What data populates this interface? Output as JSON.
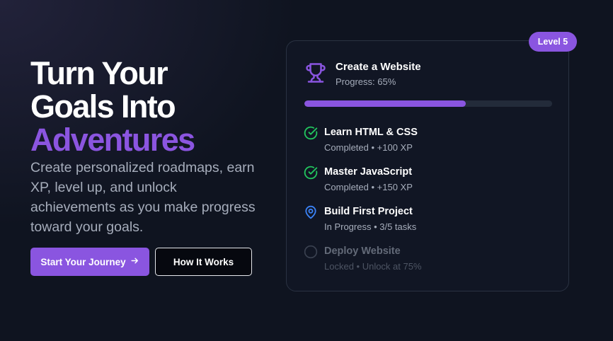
{
  "hero": {
    "headline_line1": "Turn Your",
    "headline_line2": "Goals Into",
    "headline_accent": "Adventures",
    "subtitle": "Create personalized roadmaps, earn XP, level up, and unlock achievements as you make progress toward your goals.",
    "primary_button": "Start Your Journey",
    "primary_button_icon": "arrow-right-icon",
    "secondary_button": "How It Works"
  },
  "card": {
    "badge": "Level 5",
    "icon": "trophy-icon",
    "title": "Create a Website",
    "progress_label": "Progress: 65%",
    "progress": 0.65,
    "tasks": [
      {
        "title": "Learn HTML & CSS",
        "sub": "Completed • +100 XP",
        "status": "completed",
        "icon": "check-circle-icon"
      },
      {
        "title": "Master JavaScript",
        "sub": "Completed • +150 XP",
        "status": "completed",
        "icon": "check-circle-icon"
      },
      {
        "title": "Build First Project",
        "sub": "In Progress • 3/5 tasks",
        "status": "in-progress",
        "icon": "map-pin-icon"
      },
      {
        "title": "Deploy Website",
        "sub": "Locked • Unlock at 75%",
        "status": "locked",
        "icon": "circle-icon"
      }
    ]
  },
  "colors": {
    "accent": "#8a55e0",
    "background": "#0f1420",
    "success": "#22c55e",
    "in_progress": "#3b82f6",
    "muted_text": "#a6adbb"
  }
}
